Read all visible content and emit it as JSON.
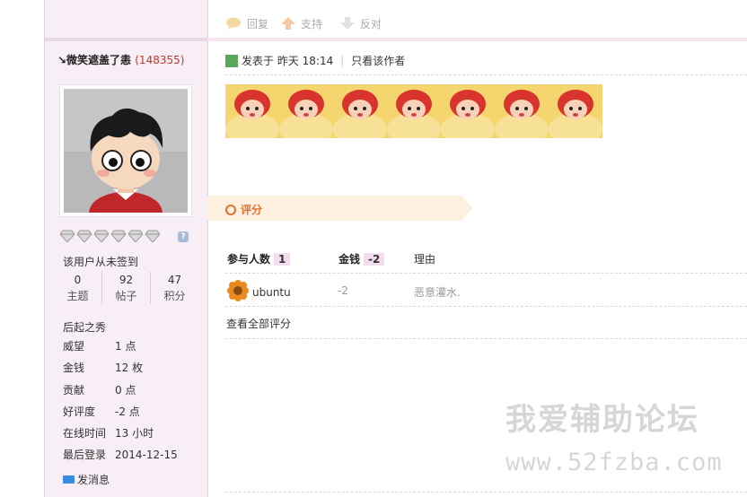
{
  "sidebar": {
    "author_name": "↘微笑遮盖了恚",
    "author_uid": "(148355)",
    "sign_status": "该用户从未签到",
    "stats": [
      {
        "num": "0",
        "label": "主题"
      },
      {
        "num": "92",
        "label": "帖子"
      },
      {
        "num": "47",
        "label": "积分"
      }
    ],
    "group_name": "后起之秀",
    "profile": [
      {
        "k": "威望",
        "v": "1 点"
      },
      {
        "k": "金钱",
        "v": "12 枚"
      },
      {
        "k": "贡献",
        "v": "0 点"
      },
      {
        "k": "好评度",
        "v": "-2 点"
      },
      {
        "k": "在线时间",
        "v": "13 小时"
      },
      {
        "k": "最后登录",
        "v": "2014-12-15"
      }
    ],
    "send_message": "发消息",
    "medal_help": "?"
  },
  "actions": {
    "reply": "回复",
    "support": "支持",
    "oppose": "反对"
  },
  "post": {
    "posted_at": "发表于 昨天 18:14",
    "only_author": "只看该作者"
  },
  "rating": {
    "title": "评分",
    "participants_label": "参与人数",
    "participants_count": "1",
    "money_label": "金钱",
    "money_total": "-2",
    "reason_label": "理由",
    "rows": [
      {
        "user": "ubuntu",
        "value": "-2",
        "reason": "恶意灌水."
      }
    ],
    "view_all": "查看全部评分"
  },
  "watermark": {
    "line1": "我爱辅助论坛",
    "line2": "www.52fzba.com"
  },
  "colors": {
    "sidebar_bg": "#f8eef6",
    "accent_orange": "#e0702d",
    "uid_red": "#c0392b",
    "badge_bg": "#f3dcef"
  }
}
